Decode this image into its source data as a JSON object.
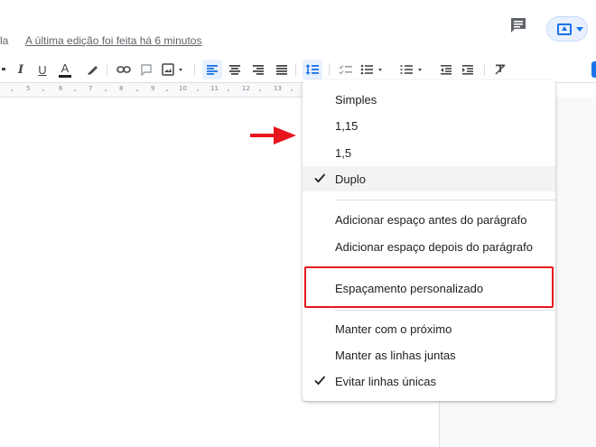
{
  "header": {
    "doc_menu_tail": "la",
    "last_edit": "A última edição foi feita há 6 minutos",
    "comment_icon": "comment-icon",
    "present_icon": "present-to-all-icon"
  },
  "toolbar": {
    "icons": [
      "italic-icon",
      "underline-icon",
      "text-color-icon",
      "highlight-icon",
      "insert-link-icon",
      "add-comment-icon",
      "insert-image-icon",
      "align-left-icon",
      "align-center-icon",
      "align-right-icon",
      "justify-icon",
      "line-spacing-icon",
      "checklist-icon",
      "bulleted-list-icon",
      "numbered-list-icon",
      "decrease-indent-icon",
      "increase-indent-icon",
      "clear-formatting-icon"
    ],
    "italic": "I",
    "underline": "U",
    "text_color": "A"
  },
  "ruler": {
    "marks": [
      "5",
      "6",
      "7",
      "8",
      "9",
      "10",
      "11",
      "12",
      "13"
    ]
  },
  "line_spacing_menu": {
    "items": [
      {
        "label": "Simples",
        "checked": false
      },
      {
        "label": "1,15",
        "checked": false
      },
      {
        "label": "1,5",
        "checked": false
      },
      {
        "label": "Duplo",
        "checked": true
      }
    ],
    "paragraph_items": [
      {
        "label": "Adicionar espaço antes do parágrafo"
      },
      {
        "label": "Adicionar espaço depois do parágrafo"
      }
    ],
    "custom_item": {
      "label": "Espaçamento personalizado"
    },
    "keep_items": [
      {
        "label": "Manter com o próximo",
        "checked": false
      },
      {
        "label": "Manter as linhas juntas",
        "checked": false
      },
      {
        "label": "Evitar linhas únicas",
        "checked": true
      }
    ]
  },
  "annotation": {
    "arrow_color": "#e8151e",
    "highlight_color": "#e8151e"
  },
  "colors": {
    "accent": "#1a73e8",
    "menu_selected_bg": "#f1f3f4",
    "text": "#202124"
  }
}
